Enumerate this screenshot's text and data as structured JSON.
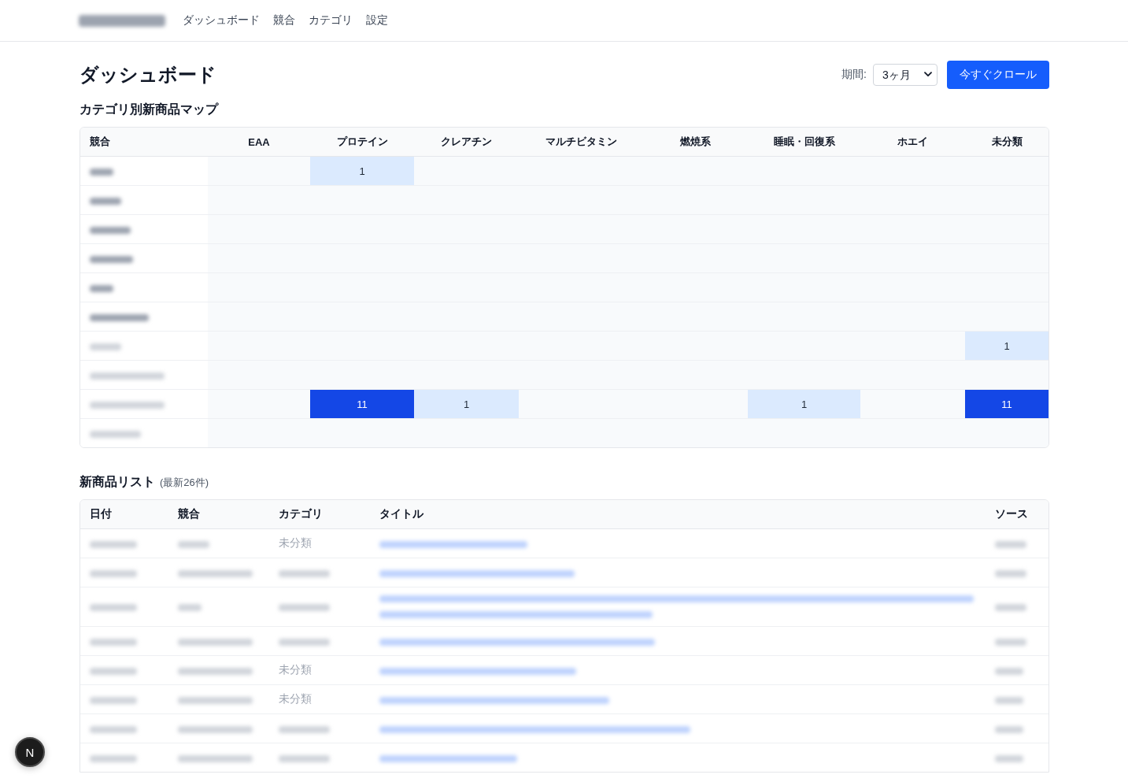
{
  "header": {
    "logo": {
      "redacted": true
    },
    "nav": [
      "ダッシュボード",
      "競合",
      "カテゴリ",
      "設定"
    ]
  },
  "page": {
    "title": "ダッシュボード",
    "period": {
      "label": "期間:",
      "value": "3ヶ月"
    },
    "crawl_button": "今すぐクロール"
  },
  "heatmap": {
    "title": "カテゴリ別新商品マップ",
    "corner": "競合",
    "columns": [
      "EAA",
      "プロテイン",
      "クレアチン",
      "マルチビタミン",
      "燃焼系",
      "睡眠・回復系",
      "ホエイ",
      "未分類"
    ],
    "rows": [
      {
        "competitor": {
          "redacted": true,
          "muted": false
        },
        "cells": [
          null,
          "1",
          null,
          null,
          null,
          null,
          null,
          null
        ]
      },
      {
        "competitor": {
          "redacted": true,
          "muted": false
        },
        "cells": [
          null,
          null,
          null,
          null,
          null,
          null,
          null,
          null
        ]
      },
      {
        "competitor": {
          "redacted": true,
          "muted": false
        },
        "cells": [
          null,
          null,
          null,
          null,
          null,
          null,
          null,
          null
        ]
      },
      {
        "competitor": {
          "redacted": true,
          "muted": false
        },
        "cells": [
          null,
          null,
          null,
          null,
          null,
          null,
          null,
          null
        ]
      },
      {
        "competitor": {
          "redacted": true,
          "muted": false
        },
        "cells": [
          null,
          null,
          null,
          null,
          null,
          null,
          null,
          null
        ]
      },
      {
        "competitor": {
          "redacted": true,
          "muted": false
        },
        "cells": [
          null,
          null,
          null,
          null,
          null,
          null,
          null,
          null
        ]
      },
      {
        "competitor": {
          "redacted": true,
          "muted": true
        },
        "cells": [
          null,
          null,
          null,
          null,
          null,
          null,
          null,
          "1"
        ]
      },
      {
        "competitor": {
          "redacted": true,
          "muted": true
        },
        "cells": [
          null,
          null,
          null,
          null,
          null,
          null,
          null,
          null
        ]
      },
      {
        "competitor": {
          "redacted": true,
          "muted": true
        },
        "cells": [
          null,
          "11",
          "1",
          null,
          null,
          "1",
          null,
          "11"
        ]
      },
      {
        "competitor": {
          "redacted": true,
          "muted": true
        },
        "cells": [
          null,
          null,
          null,
          null,
          null,
          null,
          null,
          null
        ]
      }
    ]
  },
  "products": {
    "title": "新商品リスト",
    "count": "(最新26件)",
    "columns": [
      "日付",
      "競合",
      "カテゴリ",
      "タイトル",
      "ソース"
    ],
    "rows": [
      {
        "date": {
          "redacted": true
        },
        "competitor": {
          "redacted": true
        },
        "category": {
          "text": "未分類"
        },
        "title": {
          "redacted": true,
          "wraps": false
        },
        "source": {
          "redacted": true
        }
      },
      {
        "date": {
          "redacted": true
        },
        "competitor": {
          "redacted": true
        },
        "category": {
          "redacted": true
        },
        "title": {
          "redacted": true,
          "wraps": false
        },
        "source": {
          "redacted": true
        }
      },
      {
        "date": {
          "redacted": true
        },
        "competitor": {
          "redacted": true
        },
        "category": {
          "redacted": true
        },
        "title": {
          "redacted": true,
          "wraps": true
        },
        "source": {
          "redacted": true
        }
      },
      {
        "date": {
          "redacted": true
        },
        "competitor": {
          "redacted": true
        },
        "category": {
          "redacted": true
        },
        "title": {
          "redacted": true,
          "wraps": false
        },
        "source": {
          "redacted": true
        }
      },
      {
        "date": {
          "redacted": true
        },
        "competitor": {
          "redacted": true
        },
        "category": {
          "text": "未分類"
        },
        "title": {
          "redacted": true,
          "wraps": false
        },
        "source": {
          "redacted": true
        }
      },
      {
        "date": {
          "redacted": true
        },
        "competitor": {
          "redacted": true
        },
        "category": {
          "text": "未分類"
        },
        "title": {
          "redacted": true,
          "wraps": false
        },
        "source": {
          "redacted": true
        }
      },
      {
        "date": {
          "redacted": true
        },
        "competitor": {
          "redacted": true
        },
        "category": {
          "redacted": true
        },
        "title": {
          "redacted": true,
          "wraps": false
        },
        "source": {
          "redacted": true
        }
      },
      {
        "date": {
          "redacted": true
        },
        "competitor": {
          "redacted": true
        },
        "category": {
          "redacted": true
        },
        "title": {
          "redacted": true,
          "wraps": false
        },
        "source": {
          "redacted": true
        }
      }
    ]
  },
  "dev_badge": "N"
}
